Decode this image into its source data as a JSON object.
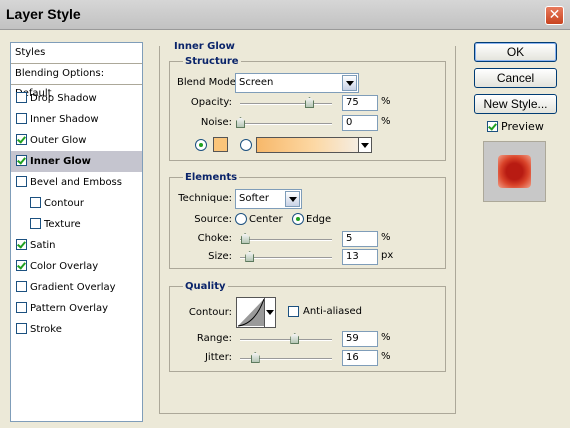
{
  "window": {
    "title": "Layer Style"
  },
  "styles_list": {
    "header": "Styles",
    "blending_options": "Blending Options: Default",
    "items": [
      {
        "label": "Drop Shadow",
        "checked": false,
        "selected": false
      },
      {
        "label": "Inner Shadow",
        "checked": false,
        "selected": false
      },
      {
        "label": "Outer Glow",
        "checked": true,
        "selected": false
      },
      {
        "label": "Inner Glow",
        "checked": true,
        "selected": true
      },
      {
        "label": "Bevel and Emboss",
        "checked": false,
        "selected": false
      },
      {
        "label": "Contour",
        "checked": false,
        "selected": false
      },
      {
        "label": "Texture",
        "checked": false,
        "selected": false
      },
      {
        "label": "Satin",
        "checked": true,
        "selected": false
      },
      {
        "label": "Color Overlay",
        "checked": true,
        "selected": false
      },
      {
        "label": "Gradient Overlay",
        "checked": false,
        "selected": false
      },
      {
        "label": "Pattern Overlay",
        "checked": false,
        "selected": false
      },
      {
        "label": "Stroke",
        "checked": false,
        "selected": false
      }
    ]
  },
  "inner_glow": {
    "title": "Inner Glow",
    "structure": {
      "title": "Structure",
      "blend_mode_label": "Blend Mode:",
      "blend_mode_value": "Screen",
      "opacity_label": "Opacity:",
      "opacity_value": "75",
      "opacity_unit": "%",
      "opacity_fraction": 0.75,
      "noise_label": "Noise:",
      "noise_value": "0",
      "noise_unit": "%",
      "noise_fraction": 0.0,
      "color_swatch": "#fbc57a"
    },
    "elements": {
      "title": "Elements",
      "technique_label": "Technique:",
      "technique_value": "Softer",
      "source_label": "Source:",
      "source_center": "Center",
      "source_edge": "Edge",
      "source_selected": "Edge",
      "choke_label": "Choke:",
      "choke_value": "5",
      "choke_unit": "%",
      "choke_fraction": 0.05,
      "size_label": "Size:",
      "size_value": "13",
      "size_unit": "px",
      "size_fraction": 0.1
    },
    "quality": {
      "title": "Quality",
      "contour_label": "Contour:",
      "anti_aliased_label": "Anti-aliased",
      "anti_aliased_checked": false,
      "range_label": "Range:",
      "range_value": "59",
      "range_unit": "%",
      "range_fraction": 0.59,
      "jitter_label": "Jitter:",
      "jitter_value": "16",
      "jitter_unit": "%",
      "jitter_fraction": 0.16
    }
  },
  "buttons": {
    "ok": "OK",
    "cancel": "Cancel",
    "new_style": "New Style...",
    "preview_label": "Preview",
    "preview_checked": true
  },
  "colors": {
    "selected_row": "#c5c5cf",
    "section_title": "#0a246a",
    "preview_core": "#b81b12",
    "preview_glow": "#f2a28a"
  }
}
